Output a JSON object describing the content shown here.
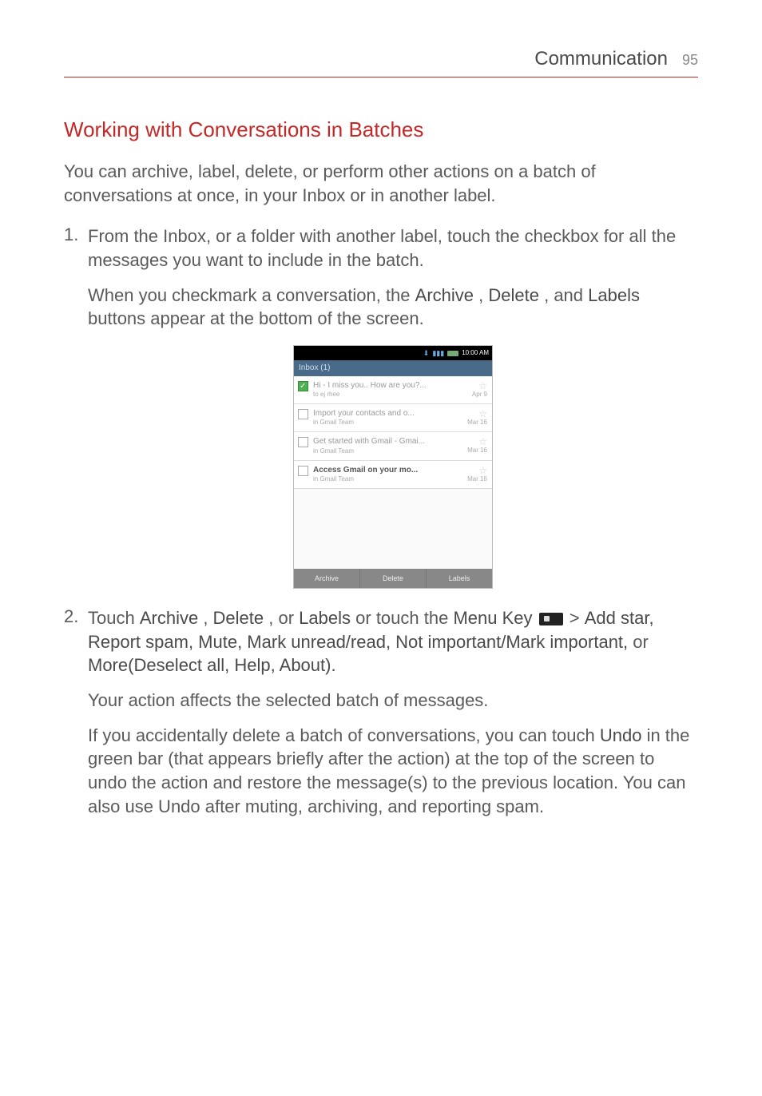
{
  "header": {
    "section": "Communication",
    "page_number": "95"
  },
  "section_title": "Working with Conversations in Batches",
  "intro": "You can archive, label, delete, or perform other actions on a batch of conversations at once, in your Inbox or in another label.",
  "steps": [
    {
      "main": "From the Inbox, or a folder with another label, touch the checkbox for all the messages you want to include in the batch.",
      "sub_pre": "When you checkmark a conversation, the ",
      "sub_b1": "Archive",
      "sub_mid1": ", ",
      "sub_b2": "Delete",
      "sub_mid2": ", and ",
      "sub_b3": "Labels",
      "sub_post": " buttons appear at the bottom of the screen."
    },
    {
      "p1_pre": "Touch ",
      "p1_b1": "Archive",
      "p1_s1": ", ",
      "p1_b2": "Delete",
      "p1_s2": ", or ",
      "p1_b3": "Labels",
      "p1_s3": " or touch the ",
      "p1_b4": "Menu Key",
      "p1_s4": " > ",
      "p1_b5": "Add star, Report spam, Mute, Mark unread/read, Not important/Mark important,",
      "p1_s5": " or ",
      "p1_b6": "More(Deselect all, Help, About).",
      "p2": "Your action affects the selected batch of messages.",
      "p3_pre": "If you accidentally delete a batch of conversations, you can touch ",
      "p3_b1": "Undo",
      "p3_post": " in the green bar (that appears briefly after the action) at the top of the screen to undo the action and restore the message(s) to the previous location. You can also use Undo after muting, archiving, and reporting spam."
    }
  ],
  "screenshot": {
    "status_time": "10:00 AM",
    "inbox_label": "Inbox (1)",
    "header_right": "",
    "rows": [
      {
        "checked": true,
        "read": true,
        "subject": "Hi - I miss you.. How are you?...",
        "sender": "to ej rhee",
        "date": "Apr 9"
      },
      {
        "checked": false,
        "read": true,
        "subject": "Import your contacts and o...",
        "sender": "in Gmail Team",
        "date": "Mar 16"
      },
      {
        "checked": false,
        "read": true,
        "subject": "Get started with Gmail - Gmai...",
        "sender": "in Gmail Team",
        "date": "Mar 16"
      },
      {
        "checked": false,
        "read": false,
        "subject": "Access Gmail on your mo...",
        "sender": "in Gmail Team",
        "date": "Mar 16"
      }
    ],
    "footer": [
      "Archive",
      "Delete",
      "Labels"
    ]
  }
}
